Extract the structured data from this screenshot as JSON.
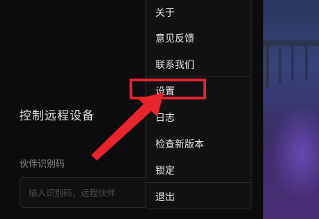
{
  "app": {
    "section_title": "控制远程设备",
    "partner_id_label": "伙伴识别码",
    "partner_id_placeholder": "输入识别码，远程伙伴"
  },
  "menu": {
    "items": [
      {
        "label": "关于"
      },
      {
        "label": "意见反馈"
      },
      {
        "label": "联系我们"
      },
      {
        "label": "设置"
      },
      {
        "label": "日志"
      },
      {
        "label": "检查新版本"
      },
      {
        "label": "锁定"
      },
      {
        "label": "退出"
      }
    ]
  },
  "annotation": {
    "highlight_color": "#e8242c",
    "arrow_color": "#e8242c",
    "icon": "red-arrow-icon"
  }
}
